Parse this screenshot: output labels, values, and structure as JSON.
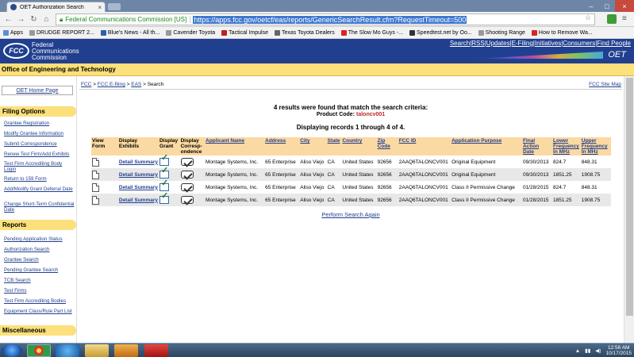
{
  "browser": {
    "tab_title": "OET Authorization Search",
    "ev_label": "Federal Communications Commission [US]",
    "url": "https://apps.fcc.gov/oetcf/eas/reports/GenericSearchResult.cfm?RequestTimeout=500",
    "bookmarks": [
      "Apps",
      "DRUDGE REPORT 2...",
      "Blue's News - All th...",
      "Cavender Toyota",
      "Tactical Impulse",
      "Texas Toyota Dealers",
      "The Slow Mo Guys -...",
      "Speedtest.net by Oo...",
      "Shooting Range",
      "How to Remove Wa..."
    ]
  },
  "banner": {
    "logo": "FCC",
    "name_line1": "Federal",
    "name_line2": "Communications",
    "name_line3": "Commission",
    "links": [
      "Search",
      "RSS",
      "Updates",
      "E-Filing",
      "Initiatives",
      "Consumers",
      "Find People"
    ],
    "oet_logo": "OET",
    "office_title": "Office of Engineering and Technology"
  },
  "sidebar": {
    "home": "OET Home Page",
    "filing_options_title": "Filing Options",
    "filing_options": [
      "Grantee Registration",
      "Modify Grantee Information",
      "Submit Correspondence",
      "Renew Test Firm/Add Exhibits",
      "Test Firm Accrediting Body Login",
      "Return to 159 Form",
      "Add/Modify Grant Deferral Date",
      "Change Short-Term Confidential Date"
    ],
    "reports_title": "Reports",
    "reports": [
      "Pending Application Status",
      "Authorization Search",
      "Grantee Search",
      "Pending Grantee Search",
      "TCB Search",
      "Test Firms",
      "Test Firm Accrediting Bodies",
      "Equipment Class/Rule Part List"
    ],
    "misc_title": "Miscellaneous"
  },
  "breadcrumb": {
    "fcc": "FCC",
    "efiling": "FCC E-filing",
    "eas": "EAS",
    "current": "Search",
    "sitemap": "FCC Site Map"
  },
  "results": {
    "summary": "4 results were found that match the search criteria:",
    "product_code_label": "Product Code:",
    "product_code": "taloncv001",
    "displaying": "Displaying records 1 through 4 of 4.",
    "perform_again": "Perform Search Again"
  },
  "table": {
    "headers": {
      "view_form": "View Form",
      "display_exhibits": "Display Exhibits",
      "display_grant": "Display Grant",
      "display_corr": "Display Corresp-ondence",
      "applicant": "Applicant Name",
      "address": "Address",
      "city": "City",
      "state": "State",
      "country": "Country",
      "zip": "Zip Code",
      "fccid": "FCC ID",
      "purpose": "Application Purpose",
      "final_action": "Final Action Date",
      "lower_freq": "Lower Frequency In MHz",
      "upper_freq": "Upper Frequency In MHz"
    },
    "detail_label": "Detail Summary",
    "rows": [
      {
        "applicant": "Montage Systems, Inc.",
        "address": "65 Enterprise",
        "city": "Aliso Viejo",
        "state": "CA",
        "country": "United States",
        "zip": "92656",
        "fccid": "2AAQ6TALONCV001",
        "purpose": "Original Equipment",
        "date": "09/30/2013",
        "lower": "824.7",
        "upper": "848.31"
      },
      {
        "applicant": "Montage Systems, Inc.",
        "address": "65 Enterprise",
        "city": "Aliso Viejo",
        "state": "CA",
        "country": "United States",
        "zip": "92656",
        "fccid": "2AAQ6TALONCV001",
        "purpose": "Original Equipment",
        "date": "09/30/2013",
        "lower": "1851.25",
        "upper": "1908.75"
      },
      {
        "applicant": "Montage Systems, Inc.",
        "address": "65 Enterprise",
        "city": "Aliso Viejo",
        "state": "CA",
        "country": "United States",
        "zip": "92656",
        "fccid": "2AAQ6TALONCV001",
        "purpose": "Class II Permissive Change",
        "date": "01/28/2015",
        "lower": "824.7",
        "upper": "848.31"
      },
      {
        "applicant": "Montage Systems, Inc.",
        "address": "65 Enterprise",
        "city": "Aliso Viejo",
        "state": "CA",
        "country": "United States",
        "zip": "92656",
        "fccid": "2AAQ6TALONCV001",
        "purpose": "Class II Permissive Change",
        "date": "01/28/2015",
        "lower": "1851.25",
        "upper": "1908.75"
      }
    ]
  },
  "taskbar": {
    "time": "12:56 AM",
    "date": "10/17/2015"
  }
}
